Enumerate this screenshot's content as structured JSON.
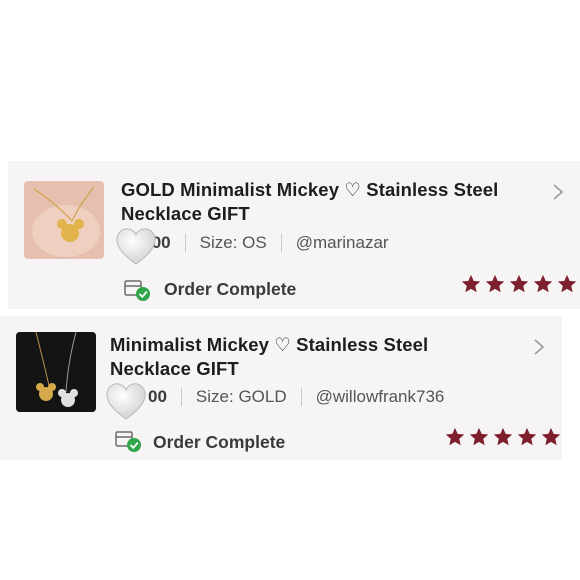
{
  "orders": [
    {
      "title_line1": "GOLD  Minimalist Mickey ♡ Stainless Steel",
      "title_line2": "Necklace GIFT",
      "price": ".00",
      "size": "Size: OS",
      "seller": "@marinazar",
      "status": "Order Complete",
      "rating": 5
    },
    {
      "title_line1": "Minimalist Mickey ♡ Stainless Steel",
      "title_line2": "Necklace GIFT",
      "price": "00",
      "size": "Size: GOLD",
      "seller": "@willowfrank736",
      "status": "Order Complete",
      "rating": 5
    }
  ],
  "icons": {
    "chevron": "chevron-right-icon",
    "status": "order-complete-icon",
    "star": "star-icon",
    "heart": "heart-icon"
  },
  "colors": {
    "star": "#7d1f2e",
    "check": "#2fa64a",
    "card_bg": "#f6f4f5",
    "heart": "#d9d9d9"
  }
}
